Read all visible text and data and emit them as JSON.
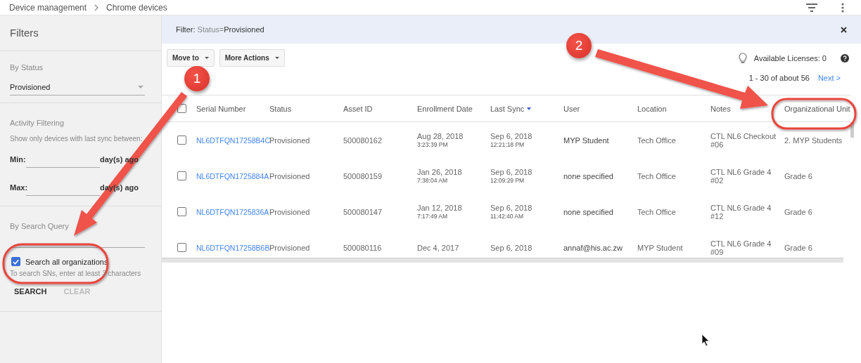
{
  "breadcrumb": [
    {
      "label": "Device management"
    },
    {
      "label": "Chrome devices"
    }
  ],
  "sidebar": {
    "title": "Filters",
    "status": {
      "label": "By Status",
      "value": "Provisioned"
    },
    "activity": {
      "label": "Activity Filtering",
      "hint": "Show only devices with last sync between:",
      "fields": [
        {
          "label": "Min:",
          "unit": "day(s) ago"
        },
        {
          "label": "Max:",
          "unit": "day(s) ago"
        }
      ]
    },
    "search": {
      "label": "By Search Query",
      "option": {
        "label": "Search all organizations",
        "checked": true
      },
      "hint": "To search SNs, enter at least 3 characters",
      "buttons": [
        {
          "label": "SEARCH",
          "disabled": false
        },
        {
          "label": "CLEAR",
          "disabled": true
        }
      ]
    }
  },
  "filter_bar": {
    "label": "Filter:",
    "key": "Status=",
    "value": "Provisioned"
  },
  "actions": [
    {
      "label": "Move to"
    },
    {
      "label": "More Actions"
    }
  ],
  "licenses": "Available Licenses: 0",
  "pagination": {
    "range": "1 - 30 of about 56",
    "next": "Next >"
  },
  "table": {
    "select_all": {
      "checked": false
    },
    "columns": [
      {
        "label": "Serial Number",
        "sorted": false
      },
      {
        "label": "Status",
        "sorted": false
      },
      {
        "label": "Asset ID",
        "sorted": false
      },
      {
        "label": "Enrollment Date",
        "sorted": false
      },
      {
        "label": "Last Sync",
        "sorted": true
      },
      {
        "label": "User",
        "sorted": false
      },
      {
        "label": "Location",
        "sorted": false
      },
      {
        "label": "Notes",
        "sorted": false
      },
      {
        "label": "Organizational Unit",
        "sorted": false
      }
    ],
    "rows": [
      {
        "selected": false,
        "serial": "NL6DTFQN17258B4C",
        "status": "Provisioned",
        "asset": "500080162",
        "enrolled": {
          "date": "Aug 28, 2018",
          "time": "3:23:39 PM"
        },
        "synced": {
          "date": "Sep 6, 2018",
          "time": "12:21:18 PM"
        },
        "user": "MYP Student",
        "location": "Tech Office",
        "notes": "CTL NL6 Checkout #06",
        "unit": "2. MYP Students"
      },
      {
        "selected": false,
        "serial": "NL6DTFQN1725884A",
        "status": "Provisioned",
        "asset": "500080159",
        "enrolled": {
          "date": "Jan 26, 2018",
          "time": "7:38:04 AM"
        },
        "synced": {
          "date": "Sep 6, 2018",
          "time": "12:09:29 PM"
        },
        "user": "none specified",
        "location": "Tech Office",
        "notes": "CTL NL6 Grade 4 #02",
        "unit": "Grade 6"
      },
      {
        "selected": false,
        "serial": "NL6DTFQN1725836A",
        "status": "Provisioned",
        "asset": "500080147",
        "enrolled": {
          "date": "Jan 12, 2018",
          "time": "7:17:49 AM"
        },
        "synced": {
          "date": "Sep 6, 2018",
          "time": "11:42:40 AM"
        },
        "user": "none specified",
        "location": "Tech Office",
        "notes": "CTL NL6 Grade 4 #12",
        "unit": "Grade 6"
      },
      {
        "selected": false,
        "serial": "NL6DTFQN17258B6B",
        "status": "Provisioned",
        "asset": "500080116",
        "enrolled": {
          "date": "Dec 4, 2017"
        },
        "synced": {
          "date": "Sep 6, 2018"
        },
        "user": "annaf@his.ac.zw",
        "location": "MYP Student",
        "notes": "CTL NL6 Grade 4 #09",
        "unit": "Grade 6"
      }
    ]
  },
  "annotations": [
    {
      "label": "1"
    },
    {
      "label": "2"
    }
  ]
}
